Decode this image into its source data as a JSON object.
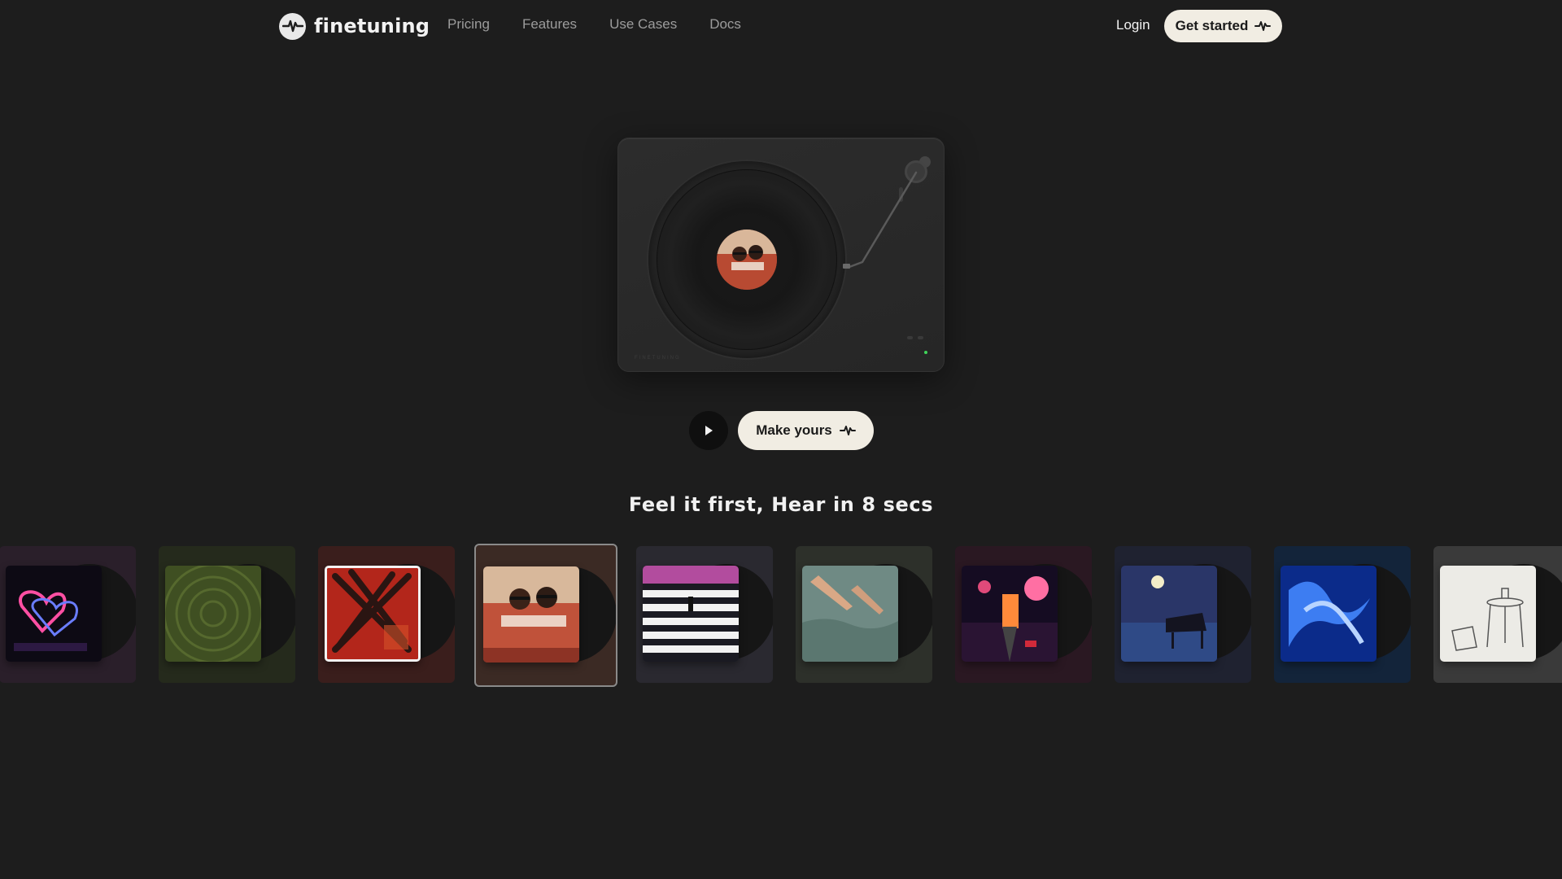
{
  "brand": {
    "name": "finetuning",
    "tiny_label": "FINETUNING"
  },
  "nav": {
    "links": [
      "Pricing",
      "Features",
      "Use Cases",
      "Docs"
    ],
    "login": "Login",
    "get_started": "Get started"
  },
  "hero": {
    "make_yours": "Make yours",
    "tagline": "Feel it first, Hear in 8 secs"
  },
  "albums": [
    {
      "name": "neon-hearts",
      "bg": "#2a1f2a"
    },
    {
      "name": "green-field",
      "bg": "#252a1c"
    },
    {
      "name": "red-abstract",
      "bg": "#3a1e1c"
    },
    {
      "name": "retro-car",
      "bg": "#3b2a24",
      "selected": true
    },
    {
      "name": "crosswalk",
      "bg": "#2a2930"
    },
    {
      "name": "water-hands",
      "bg": "#2d302a"
    },
    {
      "name": "synthwave",
      "bg": "#2a1822"
    },
    {
      "name": "moon-piano",
      "bg": "#1f2230"
    },
    {
      "name": "blue-fluid",
      "bg": "#13243a"
    },
    {
      "name": "sketch-table",
      "bg": "#3a3a3a"
    }
  ],
  "colors": {
    "background": "#1d1d1d",
    "cream_button": "#f1ede3",
    "led_green": "#3fd55a"
  }
}
